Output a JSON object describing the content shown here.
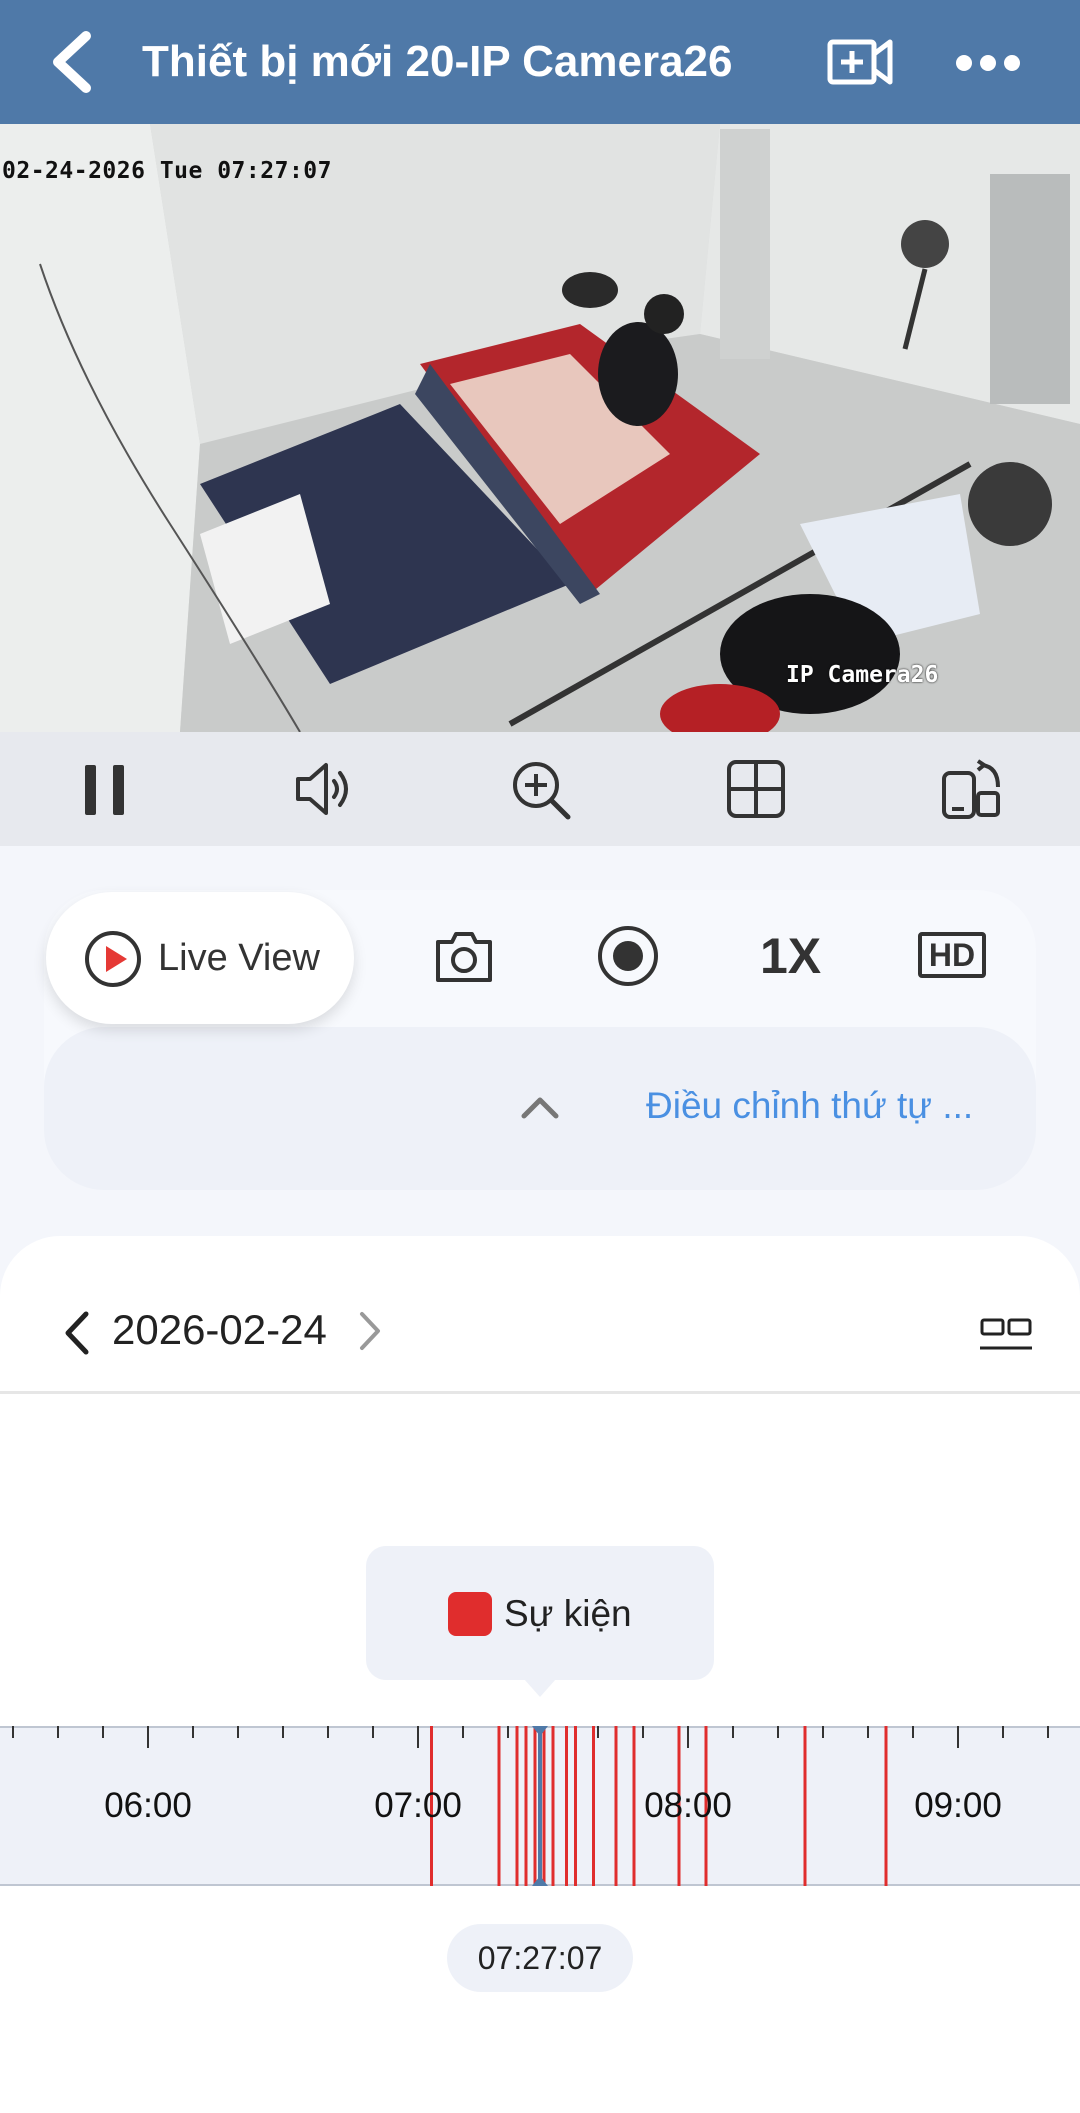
{
  "header": {
    "title": "Thiết bị mới 20-IP Camera26",
    "icons": [
      "back-chevron-icon",
      "add-video-icon",
      "more-dots-icon"
    ]
  },
  "video": {
    "osd_timestamp": "02-24-2026 Tue 07:27:07",
    "osd_camera_name": "IP Camera26"
  },
  "controls": {
    "icons": [
      "pause-icon",
      "speaker-icon",
      "zoom-in-icon",
      "grid-icon",
      "rotate-screen-icon"
    ]
  },
  "live_panel": {
    "live_label": "Live View",
    "zoom_level": "1X",
    "quality_label": "HD",
    "adjust_order_label": "Điều chỉnh thứ tự ...",
    "icons": [
      "play-circle-icon",
      "camera-icon",
      "record-icon",
      "chevron-up-icon"
    ]
  },
  "playback": {
    "date": "2026-02-24",
    "legend_label": "Sự kiện",
    "cursor_time": "07:27:07",
    "colors": {
      "event": "#e02d2d",
      "cursor": "#4f79a8",
      "accent": "#4a90e2"
    },
    "timeline": {
      "hour_labels": [
        "06:00",
        "07:00",
        "08:00",
        "09:00"
      ],
      "event_times": [
        "07:03",
        "07:18",
        "07:22",
        "07:24",
        "07:26",
        "07:27",
        "07:28",
        "07:30",
        "07:33",
        "07:35",
        "07:39",
        "07:44",
        "07:48",
        "07:58",
        "08:04",
        "08:26",
        "08:44"
      ]
    }
  }
}
